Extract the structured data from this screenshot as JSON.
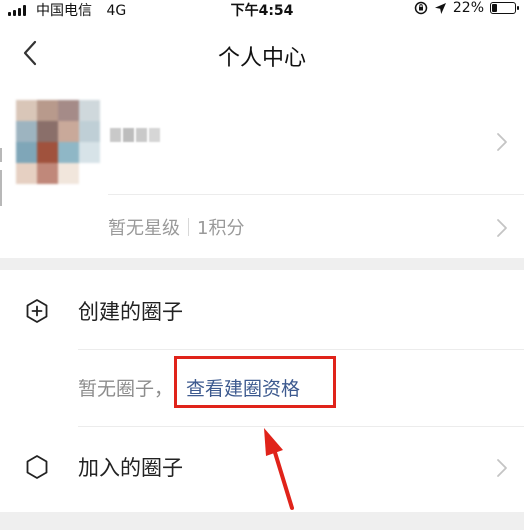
{
  "status_bar": {
    "carrier": "中国电信",
    "network": "4G",
    "time": "下午4:54",
    "battery_percent": "22%",
    "battery_level": 0.22
  },
  "nav": {
    "title": "个人中心"
  },
  "profile": {
    "level_text": "暂无星级",
    "points_text": "1积分"
  },
  "circles": {
    "created_label": "创建的圈子",
    "empty_text": "暂无圈子，",
    "qualification_link": "查看建圈资格",
    "joined_label": "加入的圈子"
  },
  "colors": {
    "link": "#3d5a8f",
    "highlight": "#e0231a",
    "band": "#efefef"
  }
}
